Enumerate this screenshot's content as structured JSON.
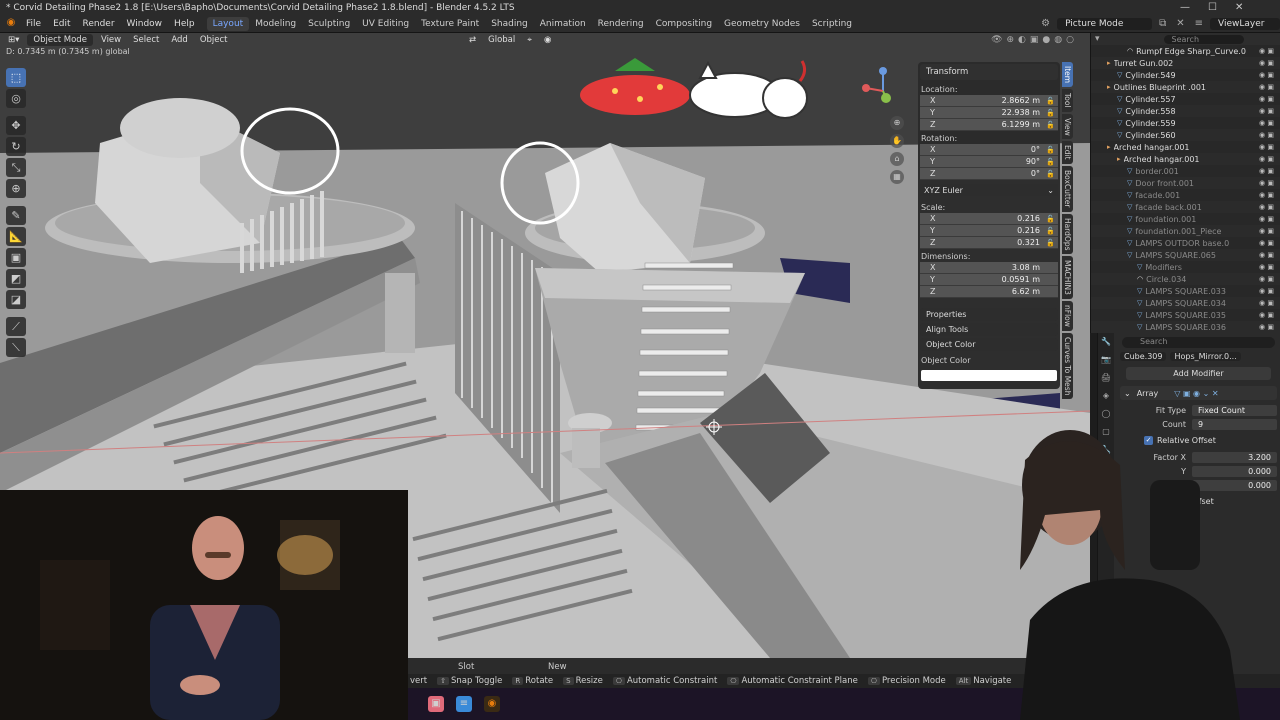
{
  "window": {
    "title": "* Corvid Detailing Phase2 1.8 [E:\\Users\\Bapho\\Documents\\Corvid Detailing Phase2 1.8.blend] - Blender 4.5.2 LTS",
    "min": "—",
    "max": "☐",
    "close": "✕"
  },
  "menu": {
    "items": [
      "File",
      "Edit",
      "Render",
      "Window",
      "Help"
    ],
    "workspaces": [
      "Layout",
      "Modeling",
      "Sculpting",
      "UV Editing",
      "Texture Paint",
      "Shading",
      "Animation",
      "Rendering",
      "Compositing",
      "Geometry Nodes",
      "Scripting"
    ],
    "scene_label": "Picture Mode",
    "view_layer": "ViewLayer"
  },
  "viewport": {
    "mode": "Object Mode",
    "menus": [
      "View",
      "Select",
      "Add",
      "Object"
    ],
    "orientation": "Global",
    "status_line": "D: 0.7345 m (0.7345 m) global"
  },
  "npanel": {
    "transform_header": "Transform",
    "location_label": "Location:",
    "location": [
      {
        "axis": "X",
        "value": "2.8662 m"
      },
      {
        "axis": "Y",
        "value": "22.938 m"
      },
      {
        "axis": "Z",
        "value": "6.1299 m"
      }
    ],
    "rotation_label": "Rotation:",
    "rotation": [
      {
        "axis": "X",
        "value": "0°"
      },
      {
        "axis": "Y",
        "value": "90°"
      },
      {
        "axis": "Z",
        "value": "0°"
      }
    ],
    "euler": "XYZ Euler",
    "scale_label": "Scale:",
    "scale": [
      {
        "axis": "X",
        "value": "0.216"
      },
      {
        "axis": "Y",
        "value": "0.216"
      },
      {
        "axis": "Z",
        "value": "0.321"
      }
    ],
    "dimensions_label": "Dimensions:",
    "dimensions": [
      {
        "axis": "X",
        "value": "3.08 m"
      },
      {
        "axis": "Y",
        "value": "0.0591 m"
      },
      {
        "axis": "Z",
        "value": "6.62 m"
      }
    ],
    "sections": [
      "Properties",
      "Align Tools",
      "Object Color"
    ],
    "object_color_label": "Object Color",
    "object_color": "#ffffff",
    "tabs": [
      "Item",
      "Tool",
      "View",
      "Edit",
      "BoxCutter",
      "HardOps",
      "MACHIN3",
      "nFlow",
      "Curves To Mesh"
    ]
  },
  "outliner": {
    "search_placeholder": "Search",
    "items": [
      {
        "name": "Rumpf Edge Sharp_Curve.0",
        "indent": 3,
        "type": "c",
        "dim": false
      },
      {
        "name": "Turret Gun.002",
        "indent": 1,
        "type": "o",
        "dim": false
      },
      {
        "name": "Cylinder.549",
        "indent": 2,
        "type": "m",
        "dim": false
      },
      {
        "name": "Outlines Blueprint .001",
        "indent": 1,
        "type": "o",
        "dim": false
      },
      {
        "name": "Cylinder.557",
        "indent": 2,
        "type": "m",
        "dim": false
      },
      {
        "name": "Cylinder.558",
        "indent": 2,
        "type": "m",
        "dim": false
      },
      {
        "name": "Cylinder.559",
        "indent": 2,
        "type": "m",
        "dim": false
      },
      {
        "name": "Cylinder.560",
        "indent": 2,
        "type": "m",
        "dim": false
      },
      {
        "name": "Arched hangar.001",
        "indent": 1,
        "type": "o",
        "dim": false
      },
      {
        "name": "Arched hangar.001",
        "indent": 2,
        "type": "o",
        "dim": false
      },
      {
        "name": "border.001",
        "indent": 3,
        "type": "m",
        "dim": true
      },
      {
        "name": "Door front.001",
        "indent": 3,
        "type": "m",
        "dim": true
      },
      {
        "name": "facade.001",
        "indent": 3,
        "type": "m",
        "dim": true
      },
      {
        "name": "facade back.001",
        "indent": 3,
        "type": "m",
        "dim": true
      },
      {
        "name": "foundation.001",
        "indent": 3,
        "type": "m",
        "dim": true
      },
      {
        "name": "foundation.001_Piece",
        "indent": 3,
        "type": "m",
        "dim": true
      },
      {
        "name": "LAMPS OUTDOR base.0",
        "indent": 3,
        "type": "m",
        "dim": true
      },
      {
        "name": "LAMPS SQUARE.065",
        "indent": 3,
        "type": "m",
        "dim": true
      },
      {
        "name": "Modifiers",
        "indent": 4,
        "type": "m",
        "dim": true
      },
      {
        "name": "Circle.034",
        "indent": 4,
        "type": "c",
        "dim": true
      },
      {
        "name": "LAMPS SQUARE.033",
        "indent": 4,
        "type": "m",
        "dim": true
      },
      {
        "name": "LAMPS SQUARE.034",
        "indent": 4,
        "type": "m",
        "dim": true
      },
      {
        "name": "LAMPS SQUARE.035",
        "indent": 4,
        "type": "m",
        "dim": true
      },
      {
        "name": "LAMPS SQUARE.036",
        "indent": 4,
        "type": "m",
        "dim": true
      }
    ]
  },
  "properties": {
    "search_placeholder": "Search",
    "object_name": "Cube.309",
    "modifier_name": "Hops_Mirror.0...",
    "add_modifier": "Add Modifier",
    "modifier_title": "Array",
    "fit_type_label": "Fit Type",
    "fit_type": "Fixed Count",
    "count_label": "Count",
    "count": "9",
    "relative_offset": "Relative Offset",
    "factor_x_label": "Factor X",
    "factor_x": "3.200",
    "y_label": "Y",
    "factor_y": "0.000",
    "z_label": "Z",
    "factor_z": "0.000",
    "offset_partial": "ffset"
  },
  "bottom": {
    "slot": "Slot",
    "new": "New"
  },
  "status": {
    "items": [
      {
        "key": "",
        "label": "vert"
      },
      {
        "key": "⇧",
        "label": "Snap Toggle"
      },
      {
        "key": "R",
        "label": "Rotate"
      },
      {
        "key": "S",
        "label": "Resize"
      },
      {
        "key": "⎔",
        "label": "Automatic Constraint"
      },
      {
        "key": "⎔",
        "label": "Automatic Constraint Plane"
      },
      {
        "key": "⎔",
        "label": "Precision Mode"
      },
      {
        "key": "Alt",
        "label": "Navigate"
      }
    ]
  }
}
